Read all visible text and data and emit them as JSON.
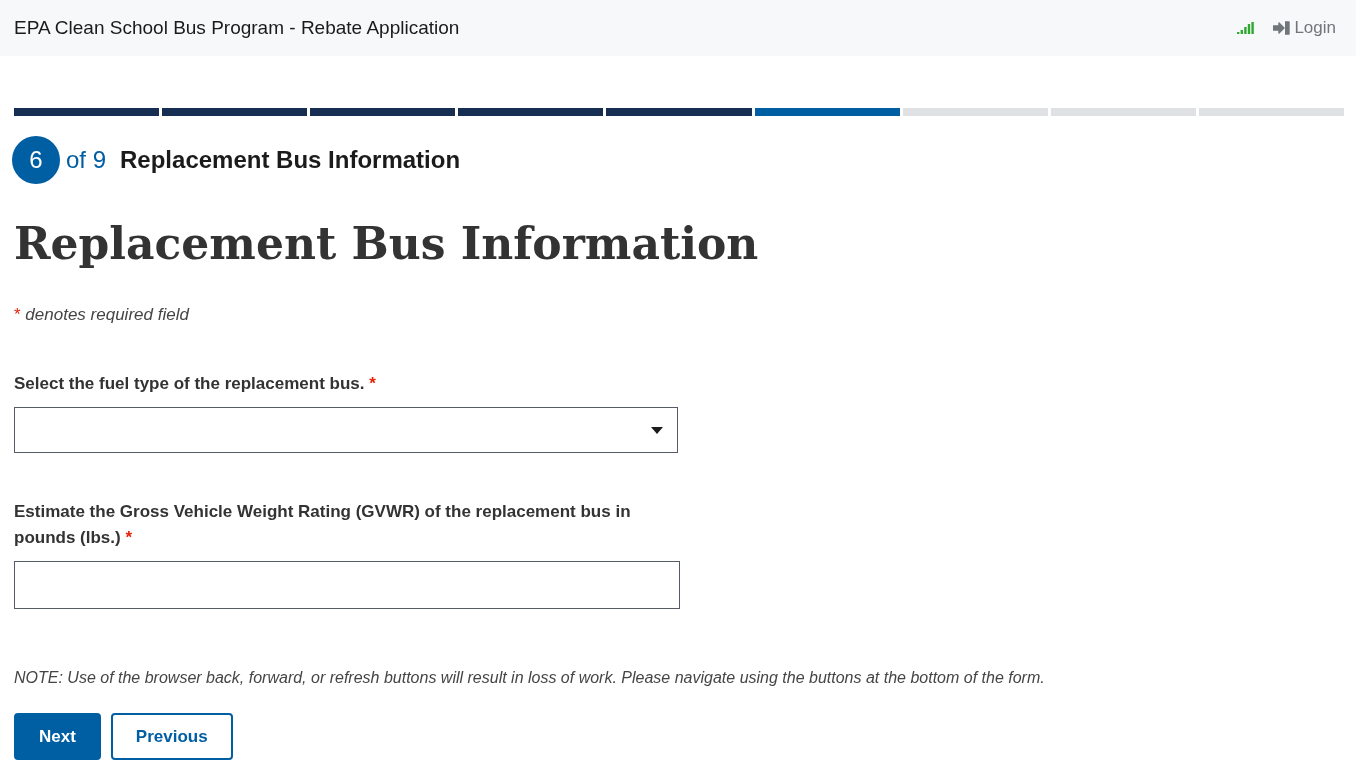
{
  "header": {
    "title": "EPA Clean School Bus Program - Rebate Application",
    "login": "Login"
  },
  "progress": [
    {
      "complete": true,
      "selected": false
    },
    {
      "complete": true,
      "selected": false
    },
    {
      "complete": true,
      "selected": false
    },
    {
      "complete": true,
      "selected": false
    },
    {
      "complete": true,
      "selected": false
    },
    {
      "complete": false,
      "selected": true
    },
    {
      "complete": false,
      "selected": false
    },
    {
      "complete": false,
      "selected": false
    },
    {
      "complete": false,
      "selected": false
    }
  ],
  "step": {
    "number": "6",
    "total": "of 9",
    "title": "Replacement Bus Information"
  },
  "heading": "Replacement Bus Information",
  "legend": {
    "mark": "*",
    "text": "denotes required field"
  },
  "fields": [
    {
      "kind": "select",
      "label": "Select the fuel type of the replacement bus.",
      "mark": "*"
    },
    {
      "kind": "text",
      "label": "Estimate the Gross Vehicle Weight Rating (GVWR) of the replacement bus in pounds (lbs.)",
      "mark": "*"
    }
  ],
  "note": "NOTE: Use of the browser back, forward, or refresh buttons will result in loss of work. Please navigate using the buttons at the bottom of the form.",
  "buttons": [
    {
      "label": "Next",
      "kind": "primary"
    },
    {
      "label": "Previous",
      "kind": "outline"
    }
  ]
}
